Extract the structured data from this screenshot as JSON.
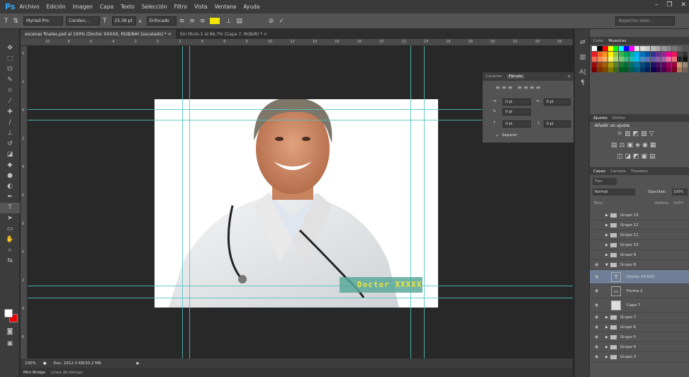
{
  "app": {
    "logo": "Ps",
    "menu": [
      "Archivo",
      "Edición",
      "Imagen",
      "Capa",
      "Texto",
      "Selección",
      "Filtro",
      "Vista",
      "Ventana",
      "Ayuda"
    ]
  },
  "options": {
    "font_family": "Myriad Pro",
    "font_style": "Conden...",
    "font_size": "25.39 pt",
    "aa_label": "a",
    "aa_mode": "Enfocado",
    "search_placeholder": "Aspectos esen..."
  },
  "tabs": [
    {
      "label": "escenas finales.psd al 100% (Doctor XXXXX, RGB/8#) [escalado] *  ×"
    },
    {
      "label": "Sin título-1 al 66.7% (Capa 7, RGB/8) *  ×"
    }
  ],
  "ruler_h": [
    "10",
    "8",
    "6",
    "4",
    "2",
    "0",
    "2",
    "4",
    "6",
    "8",
    "10",
    "12",
    "14",
    "16",
    "18",
    "20",
    "22",
    "24",
    "26",
    "28",
    "30",
    "32",
    "34",
    "36"
  ],
  "ruler_v": [
    "4",
    "2",
    "0",
    "2",
    "4",
    "6",
    "8",
    "0",
    "2",
    "4",
    "6"
  ],
  "canvas": {
    "doctor_text": "Doctor XXXXX"
  },
  "status": {
    "zoom": "100%",
    "doc_info": "Doc: 1012.5 KB/30.2 MB"
  },
  "bottom_tabs": [
    "Mini Bridge",
    "Línea de tiempo"
  ],
  "char_panel": {
    "tabs": [
      "Carácter",
      "Párrafo"
    ],
    "fields": [
      "0 pt",
      "0 pt",
      "0 pt",
      "0 pt",
      "0 pt"
    ],
    "hyphenate_label": "Separar"
  },
  "swatches": {
    "tabs": [
      "Color",
      "Muestras"
    ]
  },
  "adjust": {
    "tabs": [
      "Ajustes",
      "Estilos"
    ],
    "title": "Añadir un ajuste"
  },
  "layers_panel": {
    "tabs": [
      "Capas",
      "Canales",
      "Trazados"
    ],
    "kind_label": "Tipo",
    "blend_mode": "Normal",
    "opacity_label": "Opacidad:",
    "opacity_value": "100%",
    "lock_label": "Bloq.:",
    "fill_label": "Relleno:",
    "fill_value": "100%",
    "layers": [
      "Grupo 13",
      "Grupo 12",
      "Grupo 11",
      "Grupo 10",
      "Grupo 9",
      "Grupo 8",
      "Doctor XXXXX",
      "Forma 2",
      "Capa 7",
      "Grupo 7",
      "Grupo 6",
      "Grupo 5",
      "Grupo 4",
      "Grupo 3"
    ]
  }
}
